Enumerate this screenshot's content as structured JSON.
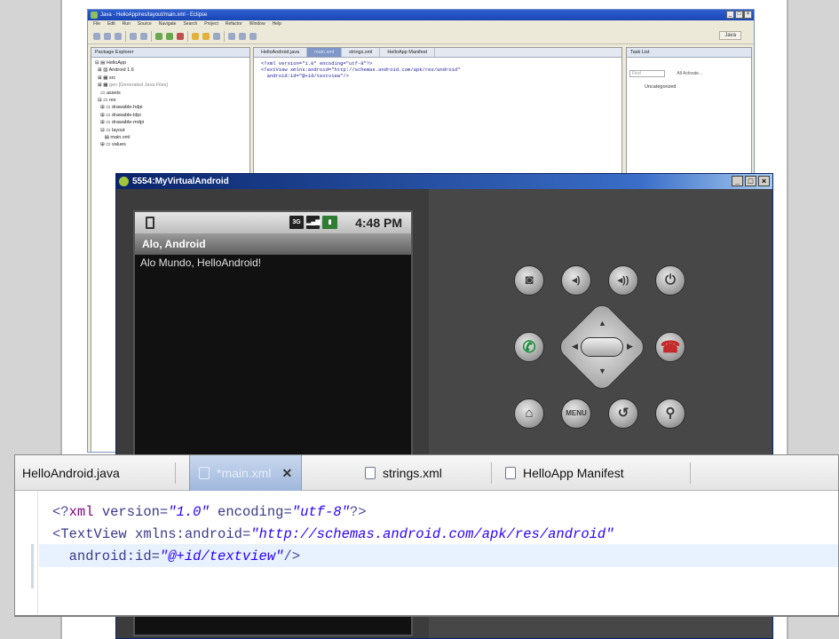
{
  "eclipse": {
    "title": "Java - HelloApp/res/layout/main.xml - Eclipse",
    "menu": [
      "File",
      "Edit",
      "Run",
      "Source",
      "Navigate",
      "Search",
      "Project",
      "Refactor",
      "Window",
      "Help"
    ],
    "perspective": "Java",
    "package_explorer": {
      "tab": "Package Explorer",
      "items": [
        "HelloApp",
        "Android 1.6",
        "src",
        "gen [Generated Java Files]",
        "assets",
        "res",
        "drawable-hdpi",
        "drawable-ldpi",
        "drawable-mdpi",
        "layout",
        "main.xml",
        "values"
      ]
    },
    "editor_tabs": [
      "HelloAndroid.java",
      "main.xml",
      "strings.xml",
      "HelloApp Manifest"
    ],
    "editor_lines": [
      "<?xml version=\"1.0\" encoding=\"utf-8\"?>",
      "<TextView xmlns:android=\"http://schemas.android.com/apk/res/android\"",
      "  android:id=\"@+id/textview\"/>"
    ],
    "task_list": {
      "tab": "Task List",
      "find": "Find",
      "actions": "All  Activate...",
      "category": "Uncategorized"
    }
  },
  "emulator": {
    "title": "5554:MyVirtualAndroid",
    "status": {
      "network": "3G",
      "time": "4:48 PM"
    },
    "app_title": "Alo, Android",
    "app_text": "Alo Mundo, HelloAndroid!",
    "controls": {
      "camera": "camera-icon",
      "vol_down": "volume-down-icon",
      "vol_up": "volume-up-icon",
      "power": "power-icon",
      "call": "call-icon",
      "hangup": "hangup-icon",
      "home": "home-icon",
      "menu_label": "MENU",
      "back": "back-icon",
      "search": "search-icon"
    }
  },
  "zoom": {
    "tabs": [
      {
        "label": "HelloAndroid.java"
      },
      {
        "label": "*main.xml"
      },
      {
        "label": "strings.xml"
      },
      {
        "label": "HelloApp Manifest"
      }
    ],
    "code": {
      "l1_open": "<?",
      "l1_tag": "xml",
      "l1_a1": " version=",
      "l1_v1": "\"1.0\"",
      "l1_a2": " encoding=",
      "l1_v2": "\"utf-8\"",
      "l1_close": "?>",
      "l2_open": "<",
      "l2_tag": "TextView",
      "l2_a1": " xmlns:android=",
      "l2_v1": "\"http://schemas.android.com/apk/res/android\"",
      "l3_a1": "  android:id=",
      "l3_v1": "\"@+id/textview\"",
      "l3_close": "/>"
    }
  }
}
